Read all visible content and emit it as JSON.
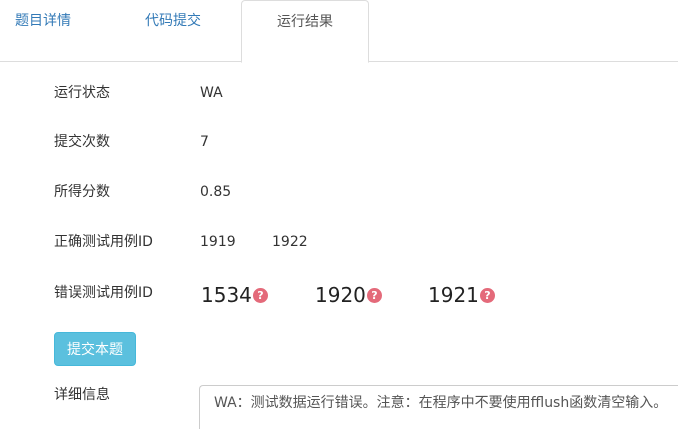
{
  "tabs": [
    {
      "label": "题目详情",
      "active": false
    },
    {
      "label": "代码提交",
      "active": false
    },
    {
      "label": "运行结果",
      "active": true
    }
  ],
  "result": {
    "status_label": "运行状态",
    "status_value": "WA",
    "submit_count_label": "提交次数",
    "submit_count_value": "7",
    "score_label": "所得分数",
    "score_value": "0.85",
    "correct_cases_label": "正确测试用例ID",
    "correct_cases": [
      "1919",
      "1922"
    ],
    "wrong_cases_label": "错误测试用例ID",
    "wrong_cases": [
      "1534",
      "1920",
      "1921"
    ]
  },
  "actions": {
    "submit_label": "提交本题"
  },
  "details": {
    "label": "详细信息",
    "text": "WA：测试数据运行错误。注意：在程序中不要使用fflush函数清空输入。"
  },
  "colors": {
    "tab_link": "#337ab7",
    "button_bg": "#5bc0de",
    "help_icon": "#e46a7a"
  },
  "icons": {
    "help": "question-circle-icon"
  }
}
